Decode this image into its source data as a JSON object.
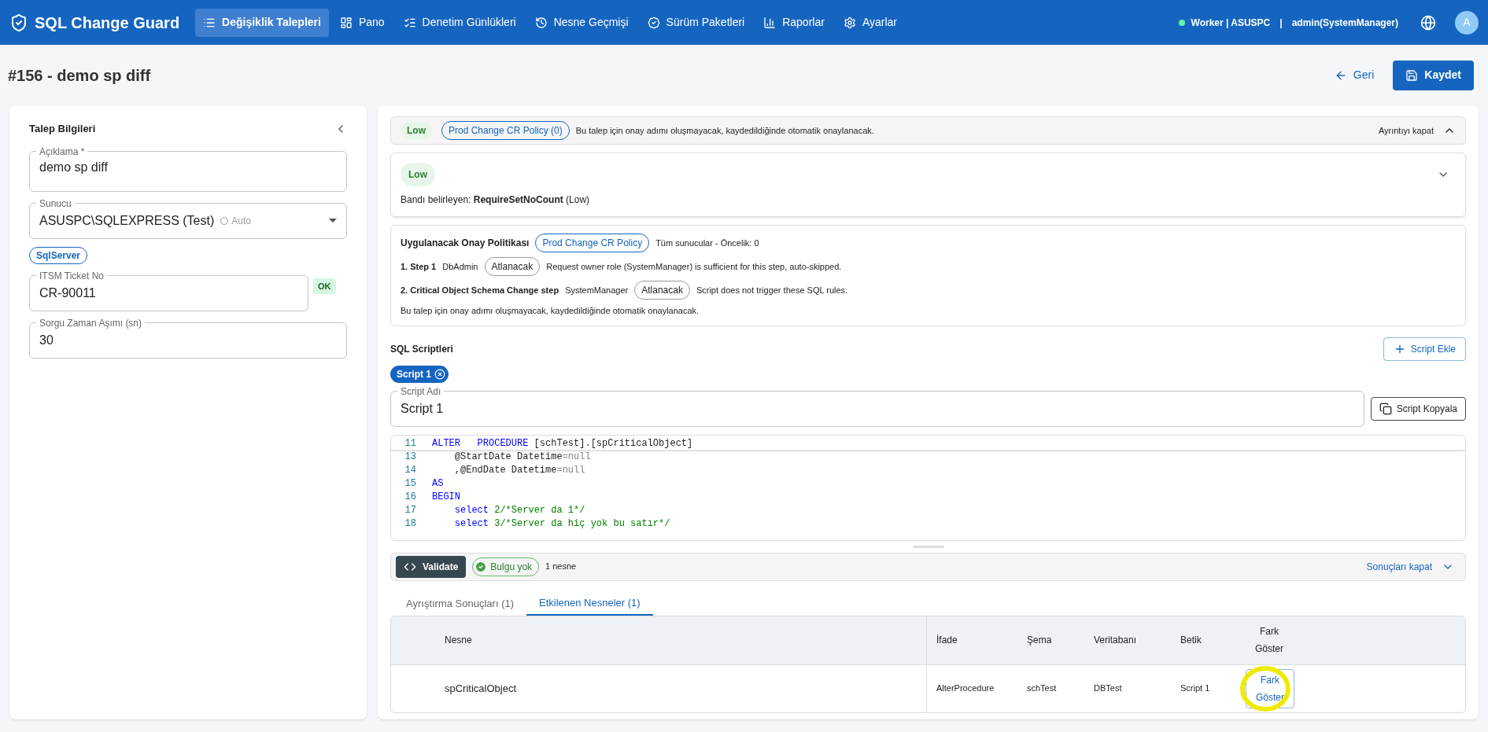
{
  "app": {
    "title": "SQL Change Guard"
  },
  "nav": [
    {
      "label": "Değişiklik Talepleri",
      "selected": true
    },
    {
      "label": "Pano",
      "selected": false
    },
    {
      "label": "Denetim Günlükleri",
      "selected": false
    },
    {
      "label": "Nesne Geçmişi",
      "selected": false
    },
    {
      "label": "Sürüm Paketleri",
      "selected": false
    },
    {
      "label": "Raporlar",
      "selected": false
    },
    {
      "label": "Ayarlar",
      "selected": false
    }
  ],
  "status": {
    "worker": "Worker | ASUSPC",
    "separator": "|",
    "user": "admin(SystemManager)",
    "avatar": "A"
  },
  "page": {
    "title": "#156 - demo sp diff",
    "back": "Geri",
    "save": "Kaydet"
  },
  "request_info": {
    "title": "Talep Bilgileri",
    "description": {
      "label": "Açıklama *",
      "value": "demo sp diff"
    },
    "server": {
      "label": "Sunucu",
      "value": "ASUSPC\\SQLEXPRESS (Test)",
      "hint": "Auto"
    },
    "server_type": "SqlServer",
    "ticket": {
      "label": "ITSM Ticket No",
      "value": "CR-90011",
      "badge": "OK"
    },
    "timeout": {
      "label": "Sorgu Zaman Aşımı (sn)",
      "value": "30"
    }
  },
  "risk_bar": {
    "band": "Low",
    "policy": "Prod Change CR Policy (0)",
    "message": "Bu talep için onay adımı oluşmayacak, kaydedildiğinde otomatik onaylanacak.",
    "toggle": "Ayrıntıyı kapat",
    "expanded": true
  },
  "risk_card": {
    "band": "Low",
    "text": "Bandı belirleyen: **RequireSetNoCount** (Low)"
  },
  "policy": {
    "title": "Uygulanacak Onay Politikası",
    "name": "Prod Change CR Policy",
    "scope": "Tüm sunucular - Öncelik: 0",
    "steps": [
      {
        "name": "1. Step 1",
        "role": "DbAdmin",
        "status": "Atlanacak",
        "note": "Request owner role (SystemManager) is sufficient for this step, auto-skipped."
      },
      {
        "name": "2. Critical Object Schema Change step",
        "role": "SystemManager",
        "status": "Atlanacak",
        "note": "Script does not trigger these SQL rules."
      }
    ],
    "footer": "Bu talep için onay adımı oluşmayacak, kaydedildiğinde otomatik onaylanacak."
  },
  "scripts": {
    "title": "SQL Scriptleri",
    "add": "Script Ekle",
    "tabs": [
      {
        "label": "Script 1",
        "selected": true
      }
    ],
    "name_field": {
      "label": "Script Adı",
      "value": "Script 1"
    },
    "copy": "Script Kopyala",
    "code": [
      {
        "number": "11",
        "tokens": [
          {
            "kind": "keyword",
            "text": "ALTER   PROCEDURE"
          },
          {
            "kind": "plain",
            "text": " [schTest].[spCriticalObject]"
          }
        ]
      },
      {
        "number": "13",
        "tokens": [
          {
            "kind": "plain",
            "text": "    @StartDate Datetime"
          },
          {
            "kind": "null",
            "text": "=null"
          }
        ]
      },
      {
        "number": "14",
        "tokens": [
          {
            "kind": "plain",
            "text": "    ,@EndDate Datetime"
          },
          {
            "kind": "null",
            "text": "=null"
          }
        ]
      },
      {
        "number": "15",
        "tokens": [
          {
            "kind": "keyword",
            "text": "AS"
          }
        ]
      },
      {
        "number": "16",
        "tokens": [
          {
            "kind": "keyword",
            "text": "BEGIN"
          }
        ]
      },
      {
        "number": "17",
        "tokens": [
          {
            "kind": "keyword",
            "text": "    select"
          },
          {
            "kind": "comment",
            "text": " 2/*Server da 1*/"
          }
        ]
      },
      {
        "number": "18",
        "tokens": [
          {
            "kind": "keyword",
            "text": "    select"
          },
          {
            "kind": "comment",
            "text": " 3/*Server da hiç yok bu satır*/"
          }
        ]
      }
    ]
  },
  "validation": {
    "button": "Validate",
    "result": "Bulgu yok",
    "count": "1 nesne",
    "toggle": "Sonuçları kapat"
  },
  "result_tabs": [
    {
      "label": "Ayrıştırma Sonuçları (1)",
      "selected": false
    },
    {
      "label": "Etkilenen Nesneler (1)",
      "selected": true
    }
  ],
  "table": {
    "columns": [
      "Nesne",
      "İfade",
      "Şema",
      "Veritabanı",
      "Betik",
      "Fark Göster"
    ],
    "rows": [
      {
        "object": "spCriticalObject",
        "statement": "AlterProcedure",
        "schema": "schTest",
        "database": "DBTest",
        "script": "Script 1",
        "action": "Fark Göster",
        "highlighted": true
      }
    ]
  }
}
